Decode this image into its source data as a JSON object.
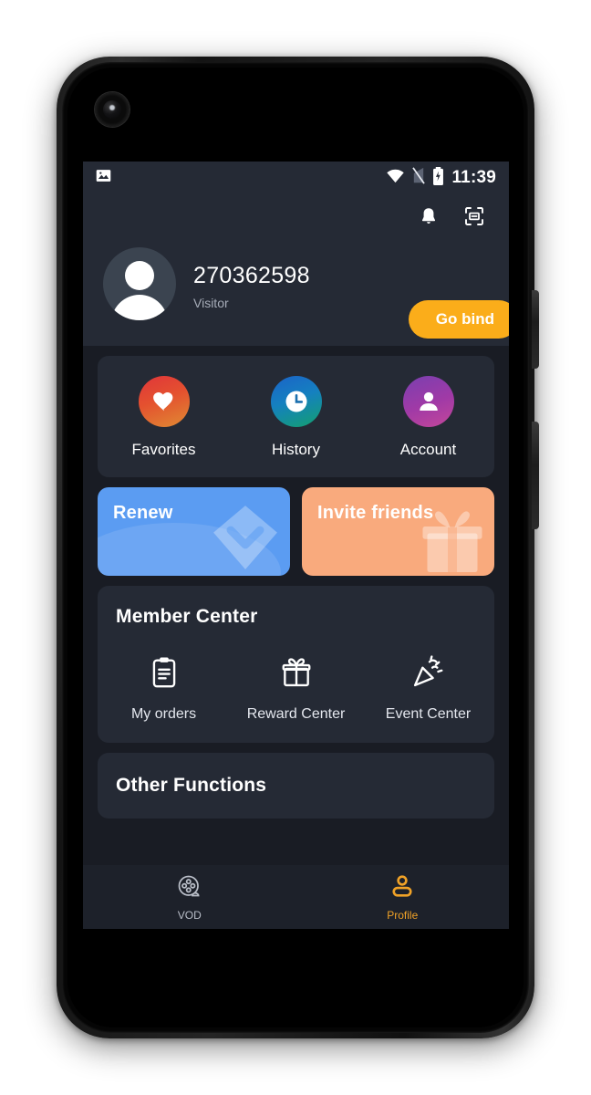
{
  "status_bar": {
    "left_icon": "image-icon",
    "wifi_icon": "wifi-icon",
    "signal_icon": "signal-off-icon",
    "battery_icon": "battery-charging-icon",
    "time": "11:39"
  },
  "header": {
    "notification_icon": "bell-icon",
    "scan_icon": "scan-frame-icon"
  },
  "profile": {
    "avatar_icon": "avatar-icon",
    "username": "270362598",
    "role": "Visitor",
    "bind_button": "Go bind",
    "bind_button_color": "#fbad1a"
  },
  "quick_actions": [
    {
      "label": "Favorites",
      "icon": "heart-icon",
      "gradient": "grad-fav"
    },
    {
      "label": "History",
      "icon": "clock-icon",
      "gradient": "grad-his"
    },
    {
      "label": "Account",
      "icon": "person-icon",
      "gradient": "grad-acc"
    }
  ],
  "promos": [
    {
      "title": "Renew",
      "icon": "diamond-icon",
      "color": "#5b9cf2"
    },
    {
      "title": "Invite friends",
      "icon": "gift-icon",
      "color": "#f9aa7d"
    }
  ],
  "member_center": {
    "title": "Member Center",
    "items": [
      {
        "label": "My orders",
        "icon": "clipboard-icon"
      },
      {
        "label": "Reward Center",
        "icon": "gift-outline-icon"
      },
      {
        "label": "Event Center",
        "icon": "party-popper-icon"
      }
    ]
  },
  "other_functions": {
    "title": "Other Functions"
  },
  "bottom_nav": {
    "active": "Profile",
    "active_color": "#f0a227",
    "inactive_color": "#b9bec8",
    "items": [
      {
        "label": "VOD",
        "icon": "film-reel-icon"
      },
      {
        "label": "Profile",
        "icon": "profile-person-icon"
      }
    ]
  },
  "theme": {
    "page_bg": "#191c24",
    "card_bg": "#252a35",
    "nav_bg": "#1d212a"
  }
}
